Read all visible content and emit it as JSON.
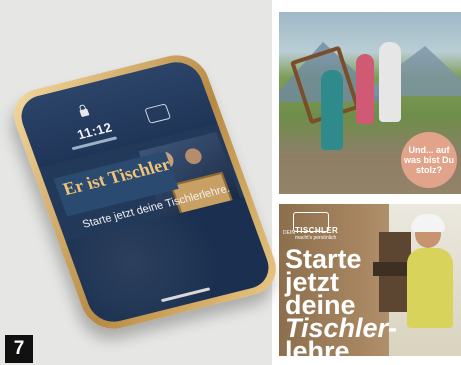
{
  "figure_number": "7",
  "phone": {
    "time": "11:12",
    "banner_text": "Er ist Tischler",
    "subtext": "Starte jetzt deine Tischlerlehre."
  },
  "photo_top": {
    "bubble_text": "Und... auf was bist Du stolz?"
  },
  "ad": {
    "logo_small": "DEIN",
    "logo_brand": "TISCHLER",
    "logo_tagline": "macht's persönlich",
    "headline_lines": [
      "Starte",
      "jetzt",
      "deine",
      "Tischler-",
      "lehre"
    ]
  },
  "colors": {
    "screen_bg": "#23395a",
    "phone_gold": "#b78a44",
    "banner_text": "#f0c27a",
    "bubble": "#e1a48a",
    "ad_text": "#ffffff"
  }
}
